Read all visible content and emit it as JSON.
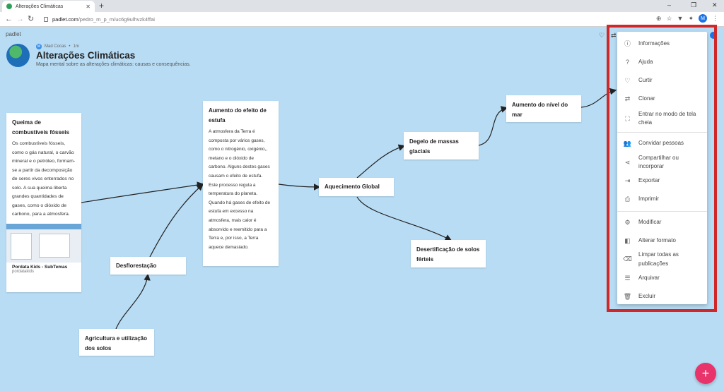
{
  "browser": {
    "tab_title": "Alterações Climáticas",
    "new_tab": "+",
    "url_domain": "padlet.com",
    "url_path": "/pedro_m_p_m/uc6g9ulhvzk4ffai",
    "profile_initial": "M",
    "window_controls": [
      "–",
      "❐",
      "✕"
    ]
  },
  "padlet": {
    "logo_text": "padlet",
    "author": "Mad Cocas",
    "author_initial": "M",
    "time_ago": "1m",
    "title": "Alterações Climáticas",
    "subtitle": "Mapa mental sobre as alterações climáticas: causas e consequências."
  },
  "cards": {
    "queima": {
      "title": "Queima de combustíveis fósseis",
      "body": "Os combustíveis fósseis, como o gás natural, o carvão mineral e o petróleo, formam-se a partir da decomposição de seres vivos enterrados no solo. A sua queima liberta grandes quantidades de gases, como o dióxido de carbono, para a atmosfera.",
      "link_title": "Pordata Kids - SubTemas",
      "link_source": "pordatakids"
    },
    "efeito_estufa": {
      "title": "Aumento do efeito de estufa",
      "body": "A atmosfera da Terra é composta por vários gases, como o nitrogénio, oxigénio,, metano e o dióxido de carbono. Alguns destes gases causam o efeito de estufa. Este processo regula a temperatura do planeta. Quando há gases de efeito de estufa em excesso na atmosfera, mais calor é absorvido e reemitido para a Terra e, por isso, a Terra aquece demasiado."
    },
    "aquecimento": {
      "title": "Aquecimento Global"
    },
    "degelo": {
      "title": "Degelo de massas glaciais"
    },
    "nivel_mar": {
      "title": "Aumento do nível do mar"
    },
    "desertificacao": {
      "title": "Desertificação de solos férteis"
    },
    "desflorestacao": {
      "title": "Desflorestação"
    },
    "agricultura": {
      "title": "Agricultura e utilização dos solos"
    }
  },
  "menu": {
    "items": [
      {
        "label": "Informações",
        "icon": "info-icon",
        "glyph": "ⓘ"
      },
      {
        "label": "Ajuda",
        "icon": "help-icon",
        "glyph": "?"
      },
      {
        "label": "Curtir",
        "icon": "heart-icon",
        "glyph": "♡"
      },
      {
        "label": "Clonar",
        "icon": "clone-icon",
        "glyph": "⇄"
      },
      {
        "label": "Entrar no modo de tela cheia",
        "icon": "fullscreen-icon",
        "glyph": "⛶"
      },
      {
        "label": "Convidar pessoas",
        "icon": "add-people-icon",
        "glyph": "👥"
      },
      {
        "label": "Compartilhar ou incorporar",
        "icon": "share-icon",
        "glyph": "⋖"
      },
      {
        "label": "Exportar",
        "icon": "export-icon",
        "glyph": "⇥"
      },
      {
        "label": "Imprimir",
        "icon": "print-icon",
        "glyph": "⎙"
      },
      {
        "label": "Modificar",
        "icon": "gear-icon",
        "glyph": "⚙"
      },
      {
        "label": "Alterar formato",
        "icon": "format-icon",
        "glyph": "◧"
      },
      {
        "label": "Limpar todas as publicações",
        "icon": "eraser-icon",
        "glyph": "⌫"
      },
      {
        "label": "Arquivar",
        "icon": "archive-icon",
        "glyph": "☰"
      },
      {
        "label": "Excluir",
        "icon": "trash-icon",
        "glyph": "🗑"
      }
    ]
  },
  "fab": {
    "label": "+"
  },
  "colors": {
    "background": "#b8dcf4",
    "highlight": "#d02828",
    "fab": "#e8336b",
    "accent": "#1a73e8"
  }
}
